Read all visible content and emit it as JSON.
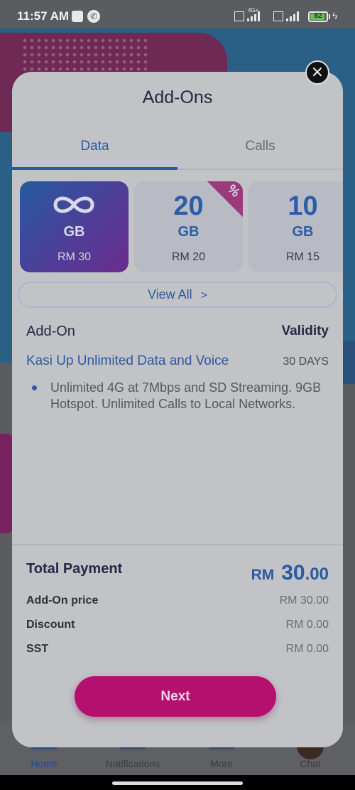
{
  "status_bar": {
    "time": "11:57 AM",
    "network_tag": "4G+",
    "battery_level": "82",
    "battery_fraction": 0.82
  },
  "background_nav": {
    "items": [
      {
        "label": "Home",
        "icon": "home-icon",
        "active": true
      },
      {
        "label": "Notifications",
        "icon": "notifications-icon"
      },
      {
        "label": "More",
        "icon": "more-icon"
      },
      {
        "label": "Chat",
        "icon": "chat-avatar"
      }
    ]
  },
  "modal": {
    "title": "Add-Ons",
    "close_icon": "close-icon",
    "tabs": [
      {
        "label": "Data",
        "active": true
      },
      {
        "label": "Calls",
        "active": false
      }
    ],
    "cards": [
      {
        "amount": "∞",
        "unit": "GB",
        "price": "RM 30",
        "selected": true,
        "icon": "infinity-icon"
      },
      {
        "amount": "20",
        "unit": "GB",
        "price": "RM 20",
        "promo": "%"
      },
      {
        "amount": "10",
        "unit": "GB",
        "price": "RM 15"
      }
    ],
    "view_all_label": "View All",
    "details": {
      "addon_header": "Add-On",
      "validity_header": "Validity",
      "plan_name": "Kasi Up Unlimited Data and Voice",
      "plan_validity": "30 DAYS",
      "plan_description": "Unlimited 4G at 7Mbps and SD Streaming. 9GB Hotspot. Unlimited Calls to Local Networks."
    },
    "payment": {
      "total_label": "Total Payment",
      "total_currency": "RM",
      "total_integer": "30",
      "total_decimal": ".00",
      "rows": [
        {
          "label": "Add-On price",
          "value": "RM 30.00"
        },
        {
          "label": "Discount",
          "value": "RM 0.00"
        },
        {
          "label": "SST",
          "value": "RM 0.00"
        }
      ]
    },
    "next_label": "Next"
  },
  "colors": {
    "accent_blue": "#2a5aa0",
    "next_button": "#b5106e",
    "selected_card_start": "#245a9e",
    "selected_card_end": "#6a2c8e"
  }
}
